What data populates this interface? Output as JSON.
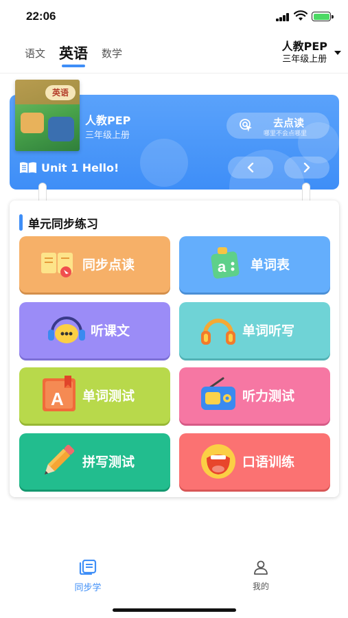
{
  "status_bar": {
    "time": "22:06"
  },
  "header": {
    "subjects": [
      {
        "label": "语文",
        "active": false
      },
      {
        "label": "英语",
        "active": true
      },
      {
        "label": "数学",
        "active": false
      }
    ],
    "book": {
      "name": "人教PEP",
      "grade": "三年级上册"
    }
  },
  "banner": {
    "cover_title": "英语",
    "book_name": "人教PEP",
    "book_grade": "三年级上册",
    "read_button": {
      "label": "去点读",
      "sub": "哪里不会点哪里"
    },
    "unit_label": "Unit 1 Hello!"
  },
  "practice": {
    "title": "单元同步练习",
    "tiles": [
      {
        "label": "同步点读",
        "color": "#f6b068",
        "icon": "sync-read-icon"
      },
      {
        "label": "单词表",
        "color": "#64aefc",
        "icon": "word-list-icon"
      },
      {
        "label": "听课文",
        "color": "#9b8cf7",
        "icon": "listen-text-icon"
      },
      {
        "label": "单词听写",
        "color": "#6fd3d6",
        "icon": "headphones-icon"
      },
      {
        "label": "单词测试",
        "color": "#b8d94b",
        "icon": "word-test-icon"
      },
      {
        "label": "听力测试",
        "color": "#f677a3",
        "icon": "radio-icon"
      },
      {
        "label": "拼写测试",
        "color": "#22bd8e",
        "icon": "pencil-icon"
      },
      {
        "label": "口语训练",
        "color": "#fb7272",
        "icon": "mouth-icon"
      }
    ]
  },
  "bottom_nav": {
    "items": [
      {
        "label": "同步学",
        "active": true,
        "icon": "book-stack-icon"
      },
      {
        "label": "我的",
        "active": false,
        "icon": "person-icon"
      }
    ]
  },
  "colors": {
    "accent": "#3e8ef7",
    "inactive": "#555555"
  }
}
